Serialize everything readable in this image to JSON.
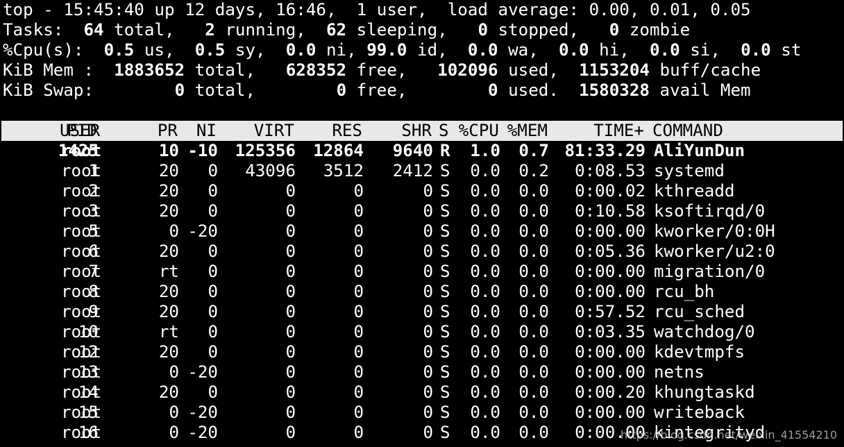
{
  "summary": {
    "l1": {
      "head": "top - 15:45:40 up 12 days, 16:46,  1 user,  load average: 0.00, 0.01, 0.05"
    },
    "l2": {
      "label": "Tasks: ",
      "total": " 64",
      "total_lbl": " total,   ",
      "running": "2",
      "running_lbl": " running,  ",
      "sleeping": "62",
      "sleeping_lbl": " sleeping,   ",
      "stopped": "0",
      "stopped_lbl": " stopped,   ",
      "zombie": "0",
      "zombie_lbl": " zombie"
    },
    "l3": {
      "label": "%Cpu(s):  ",
      "us": "0.5",
      "us_lbl": " us,  ",
      "sy": "0.5",
      "sy_lbl": " sy,  ",
      "ni": "0.0",
      "ni_lbl": " ni, ",
      "id": "99.0",
      "id_lbl": " id,  ",
      "wa": "0.0",
      "wa_lbl": " wa,  ",
      "hi": "0.0",
      "hi_lbl": " hi,  ",
      "si": "0.0",
      "si_lbl": " si,  ",
      "st": "0.0",
      "st_lbl": " st"
    },
    "l4": {
      "label": "KiB Mem :  ",
      "total": "1883652",
      "total_lbl": " total,   ",
      "free": "628352",
      "free_lbl": " free,   ",
      "used": "102096",
      "used_lbl": " used,  ",
      "buff": "1153204",
      "buff_lbl": " buff/cache"
    },
    "l5": {
      "label": "KiB Swap:        ",
      "total": "0",
      "total_lbl": " total,        ",
      "free": "0",
      "free_lbl": " free,        ",
      "used": "0",
      "used_lbl": " used.  ",
      "avail": "1580328",
      "avail_lbl": " avail Mem"
    }
  },
  "columns": {
    "pid": "PID",
    "user": "USER",
    "pr": "PR",
    "ni": "NI",
    "virt": "VIRT",
    "res": "RES",
    "shr": "SHR",
    "s": "S",
    "cpu": "%CPU",
    "mem": "%MEM",
    "time": "TIME+",
    "command": "COMMAND"
  },
  "processes": [
    {
      "pid": "1425",
      "user": "root",
      "pr": "10",
      "ni": "-10",
      "virt": "125356",
      "res": "12864",
      "shr": "9640",
      "s": "R",
      "cpu": "1.0",
      "mem": "0.7",
      "time": "81:33.29",
      "command": "AliYunDun",
      "bold": true
    },
    {
      "pid": "1",
      "user": "root",
      "pr": "20",
      "ni": "0",
      "virt": "43096",
      "res": "3512",
      "shr": "2412",
      "s": "S",
      "cpu": "0.0",
      "mem": "0.2",
      "time": "0:08.53",
      "command": "systemd"
    },
    {
      "pid": "2",
      "user": "root",
      "pr": "20",
      "ni": "0",
      "virt": "0",
      "res": "0",
      "shr": "0",
      "s": "S",
      "cpu": "0.0",
      "mem": "0.0",
      "time": "0:00.02",
      "command": "kthreadd"
    },
    {
      "pid": "3",
      "user": "root",
      "pr": "20",
      "ni": "0",
      "virt": "0",
      "res": "0",
      "shr": "0",
      "s": "S",
      "cpu": "0.0",
      "mem": "0.0",
      "time": "0:10.58",
      "command": "ksoftirqd/0"
    },
    {
      "pid": "5",
      "user": "root",
      "pr": "0",
      "ni": "-20",
      "virt": "0",
      "res": "0",
      "shr": "0",
      "s": "S",
      "cpu": "0.0",
      "mem": "0.0",
      "time": "0:00.00",
      "command": "kworker/0:0H"
    },
    {
      "pid": "6",
      "user": "root",
      "pr": "20",
      "ni": "0",
      "virt": "0",
      "res": "0",
      "shr": "0",
      "s": "S",
      "cpu": "0.0",
      "mem": "0.0",
      "time": "0:05.36",
      "command": "kworker/u2:0"
    },
    {
      "pid": "7",
      "user": "root",
      "pr": "rt",
      "ni": "0",
      "virt": "0",
      "res": "0",
      "shr": "0",
      "s": "S",
      "cpu": "0.0",
      "mem": "0.0",
      "time": "0:00.00",
      "command": "migration/0"
    },
    {
      "pid": "8",
      "user": "root",
      "pr": "20",
      "ni": "0",
      "virt": "0",
      "res": "0",
      "shr": "0",
      "s": "S",
      "cpu": "0.0",
      "mem": "0.0",
      "time": "0:00.00",
      "command": "rcu_bh"
    },
    {
      "pid": "9",
      "user": "root",
      "pr": "20",
      "ni": "0",
      "virt": "0",
      "res": "0",
      "shr": "0",
      "s": "S",
      "cpu": "0.0",
      "mem": "0.0",
      "time": "0:57.52",
      "command": "rcu_sched"
    },
    {
      "pid": "10",
      "user": "root",
      "pr": "rt",
      "ni": "0",
      "virt": "0",
      "res": "0",
      "shr": "0",
      "s": "S",
      "cpu": "0.0",
      "mem": "0.0",
      "time": "0:03.35",
      "command": "watchdog/0"
    },
    {
      "pid": "12",
      "user": "root",
      "pr": "20",
      "ni": "0",
      "virt": "0",
      "res": "0",
      "shr": "0",
      "s": "S",
      "cpu": "0.0",
      "mem": "0.0",
      "time": "0:00.00",
      "command": "kdevtmpfs"
    },
    {
      "pid": "13",
      "user": "root",
      "pr": "0",
      "ni": "-20",
      "virt": "0",
      "res": "0",
      "shr": "0",
      "s": "S",
      "cpu": "0.0",
      "mem": "0.0",
      "time": "0:00.00",
      "command": "netns"
    },
    {
      "pid": "14",
      "user": "root",
      "pr": "20",
      "ni": "0",
      "virt": "0",
      "res": "0",
      "shr": "0",
      "s": "S",
      "cpu": "0.0",
      "mem": "0.0",
      "time": "0:00.20",
      "command": "khungtaskd"
    },
    {
      "pid": "15",
      "user": "root",
      "pr": "0",
      "ni": "-20",
      "virt": "0",
      "res": "0",
      "shr": "0",
      "s": "S",
      "cpu": "0.0",
      "mem": "0.0",
      "time": "0:00.00",
      "command": "writeback"
    },
    {
      "pid": "16",
      "user": "root",
      "pr": "0",
      "ni": "-20",
      "virt": "0",
      "res": "0",
      "shr": "0",
      "s": "S",
      "cpu": "0.0",
      "mem": "0.0",
      "time": "0:00.00",
      "command": "kintegrityd"
    }
  ],
  "watermark": "https://blog.csdn.net/weixin_41554210"
}
